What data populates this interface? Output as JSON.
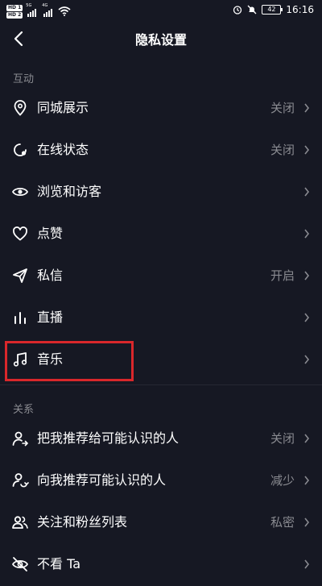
{
  "status_bar": {
    "hd1": "HD 1",
    "hd2": "HD 2",
    "net1": "5G",
    "net2": "4G",
    "battery": "42",
    "time": "16:16"
  },
  "header": {
    "title": "隐私设置"
  },
  "sections": [
    {
      "label": "互动"
    },
    {
      "label": "关系"
    }
  ],
  "rows": [
    {
      "icon": "location-pin-icon",
      "label": "同城展示",
      "value": "关闭"
    },
    {
      "icon": "online-status-icon",
      "label": "在线状态",
      "value": "关闭"
    },
    {
      "icon": "eye-icon",
      "label": "浏览和访客",
      "value": ""
    },
    {
      "icon": "heart-icon",
      "label": "点赞",
      "value": ""
    },
    {
      "icon": "paper-plane-icon",
      "label": "私信",
      "value": "开启"
    },
    {
      "icon": "live-bars-icon",
      "label": "直播",
      "value": ""
    },
    {
      "icon": "music-note-icon",
      "label": "音乐",
      "value": ""
    },
    {
      "icon": "person-share-icon",
      "label": "把我推荐给可能认识的人",
      "value": "关闭"
    },
    {
      "icon": "person-recommend-icon",
      "label": "向我推荐可能认识的人",
      "value": "减少"
    },
    {
      "icon": "people-icon",
      "label": "关注和粉丝列表",
      "value": "私密"
    },
    {
      "icon": "eye-off-icon",
      "label": "不看 Ta",
      "value": ""
    }
  ],
  "colors": {
    "background": "#161823",
    "secondary_text": "#8a8b91",
    "highlight": "#d9272b"
  }
}
